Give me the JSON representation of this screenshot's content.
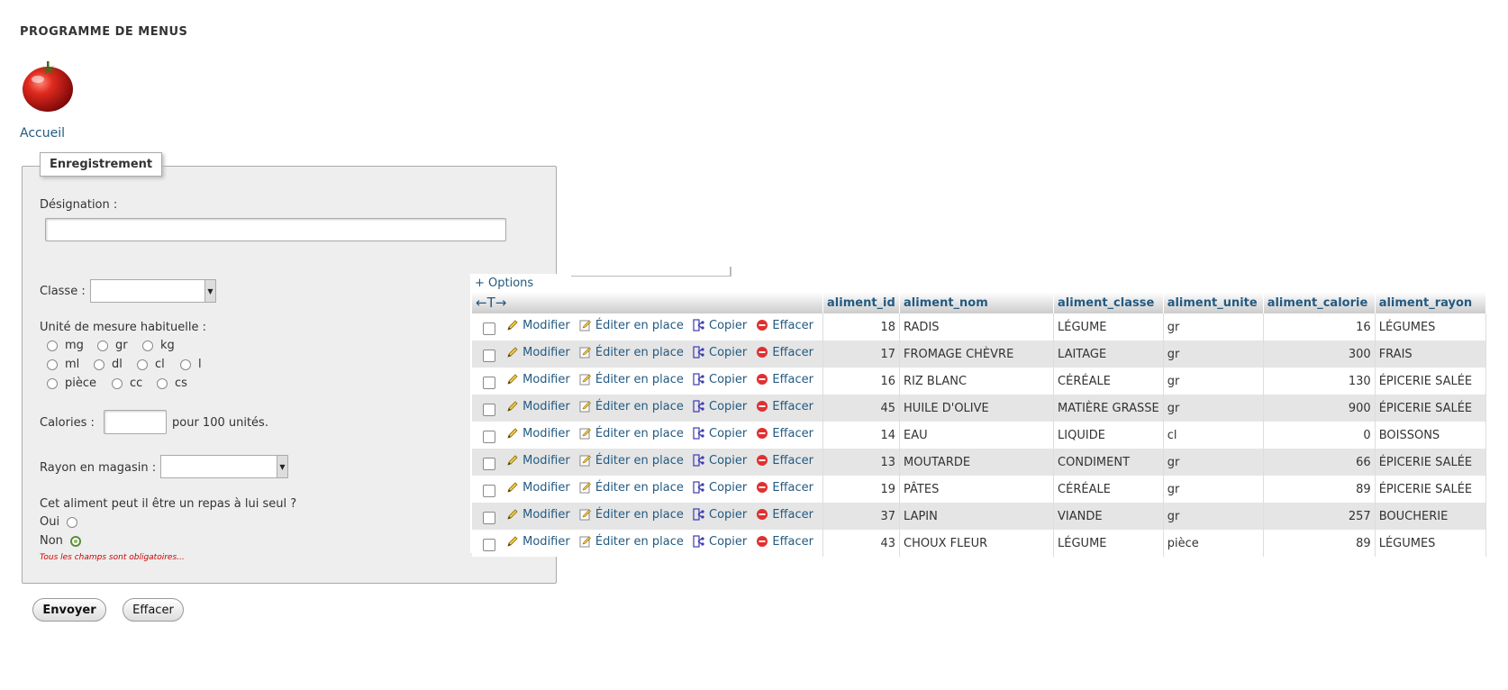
{
  "header": {
    "title": "PROGRAMME DE MENUS",
    "home_link": "Accueil"
  },
  "form": {
    "legend": "Enregistrement",
    "designation_label": "Désignation :",
    "designation_value": "",
    "classe_label": "Classe :",
    "classe_value": "",
    "unite_label": "Unité de mesure habituelle :",
    "units": [
      [
        "mg",
        "gr",
        "kg"
      ],
      [
        "ml",
        "dl",
        "cl",
        "l"
      ],
      [
        "pièce",
        "cc",
        "cs"
      ]
    ],
    "calories_label": "Calories :",
    "calories_value": "",
    "calories_suffix": "pour 100 unités.",
    "rayon_label": "Rayon en magasin :",
    "rayon_value": "",
    "repas_question": "Cet aliment peut il être un repas à lui seul ?",
    "oui_label": "Oui",
    "non_label": "Non",
    "selected_repas": "Non",
    "required_note": "Tous les champs sont obligatoires...",
    "submit_label": "Envoyer",
    "reset_label": "Effacer"
  },
  "grid": {
    "options_label": "+ Options",
    "nav_arrows": "←T→",
    "columns": [
      "aliment_id",
      "aliment_nom",
      "aliment_classe",
      "aliment_unite",
      "aliment_calorie",
      "aliment_rayon"
    ],
    "actions": {
      "edit": "Modifier",
      "inline": "Éditer en place",
      "copy": "Copier",
      "delete": "Effacer"
    },
    "rows": [
      [
        "18",
        "RADIS",
        "LÉGUME",
        "gr",
        "16",
        "LÉGUMES"
      ],
      [
        "17",
        "FROMAGE CHÈVRE",
        "LAITAGE",
        "gr",
        "300",
        "FRAIS"
      ],
      [
        "16",
        "RIZ BLANC",
        "CÉRÉALE",
        "gr",
        "130",
        "ÉPICERIE SALÉE"
      ],
      [
        "45",
        "HUILE D'OLIVE",
        "MATIÈRE GRASSE",
        "gr",
        "900",
        "ÉPICERIE SALÉE"
      ],
      [
        "14",
        "EAU",
        "LIQUIDE",
        "cl",
        "0",
        "BOISSONS"
      ],
      [
        "13",
        "MOUTARDE",
        "CONDIMENT",
        "gr",
        "66",
        "ÉPICERIE SALÉE"
      ],
      [
        "19",
        "PÂTES",
        "CÉRÉALE",
        "gr",
        "89",
        "ÉPICERIE SALÉE"
      ],
      [
        "37",
        "LAPIN",
        "VIANDE",
        "gr",
        "257",
        "BOUCHERIE"
      ],
      [
        "43",
        "CHOUX FLEUR",
        "LÉGUME",
        "pièce",
        "89",
        "LÉGUMES"
      ]
    ]
  },
  "colors": {
    "link": "#235a81",
    "error": "#cc0000",
    "row_alt": "#e5e5e5",
    "tomato": "#d81e1e"
  }
}
